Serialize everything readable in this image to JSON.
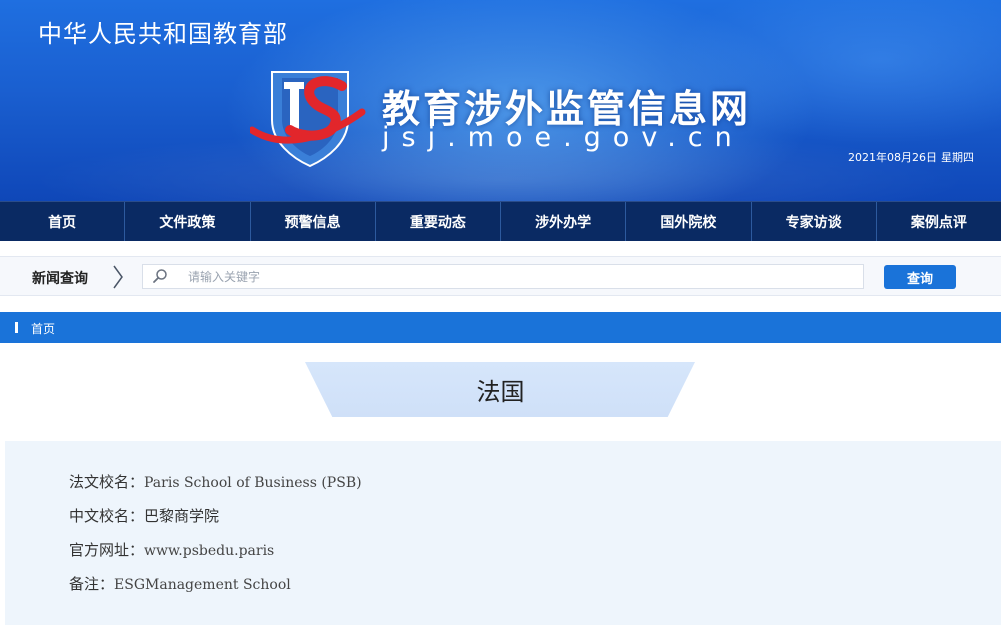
{
  "header": {
    "ministry": "中华人民共和国教育部",
    "site_title": "教育涉外监管信息网",
    "site_domain": "jsj.moe.gov.cn",
    "date": "2021年08月26日",
    "weekday": "星期四"
  },
  "nav": {
    "items": [
      "首页",
      "文件政策",
      "预警信息",
      "重要动态",
      "涉外办学",
      "国外院校",
      "专家访谈",
      "案例点评"
    ]
  },
  "search": {
    "label": "新闻查询",
    "placeholder": "请输入关键字",
    "button": "查询"
  },
  "breadcrumb": {
    "home": "首页"
  },
  "content": {
    "country": "法国",
    "rows": [
      {
        "label": "法文校名：",
        "value": "Paris School of Business (PSB)"
      },
      {
        "label": "中文校名：",
        "value": "巴黎商学院"
      },
      {
        "label": "官方网址：",
        "value": "www.psbedu.paris"
      },
      {
        "label": "备注：",
        "value": "ESGManagement School"
      }
    ]
  },
  "colors": {
    "nav_bg": "#0a2a63",
    "accent": "#1a73d9",
    "panel_bg": "#eef5fc"
  }
}
